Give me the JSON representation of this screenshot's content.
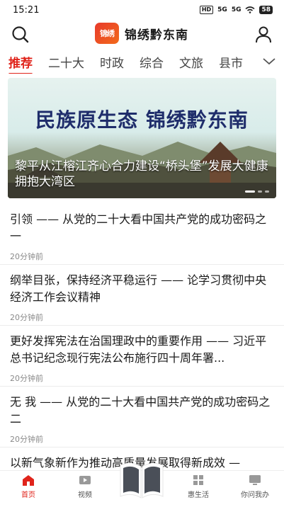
{
  "status_bar": {
    "time": "15:21",
    "network_hd": "HD",
    "signal_1": "5G",
    "signal_2": "5G",
    "battery": "58"
  },
  "header": {
    "logo_mark": "锦绣",
    "app_name": "锦绣黔东南",
    "search_icon": "search-icon",
    "user_icon": "user-icon"
  },
  "tabs": [
    {
      "label": "推荐",
      "active": true
    },
    {
      "label": "二十大",
      "active": false
    },
    {
      "label": "时政",
      "active": false
    },
    {
      "label": "综合",
      "active": false
    },
    {
      "label": "文旅",
      "active": false
    },
    {
      "label": "县市",
      "active": false
    }
  ],
  "banner": {
    "slogan": "民族原生态  锦绣黔东南",
    "caption": "黎平从江榕江齐心合力建设“桥头堡”发展大健康拥抱大湾区"
  },
  "news": [
    {
      "title": "引领 —— 从党的二十大看中国共产党的成功密码之一",
      "time": "20分钟前"
    },
    {
      "title": "纲举目张，保持经济平稳运行 —— 论学习贯彻中央经济工作会议精神",
      "time": "20分钟前"
    },
    {
      "title": "更好发挥宪法在治国理政中的重要作用 —— 习近平总书记纪念现行宪法公布施行四十周年署...",
      "time": "20分钟前"
    },
    {
      "title": "无 我 —— 从党的二十大看中国共产党的成功密码之二",
      "time": "20分钟前"
    },
    {
      "title": "以新气象新作为推动高质量发展取得新成效 —",
      "time": ""
    }
  ],
  "bottom_nav": [
    {
      "label": "首页",
      "icon": "home-icon",
      "active": true
    },
    {
      "label": "视频",
      "icon": "video-icon",
      "active": false
    },
    {
      "label": "",
      "icon": "book-icon",
      "active": false
    },
    {
      "label": "惠生活",
      "icon": "grid-icon",
      "active": false
    },
    {
      "label": "你问我办",
      "icon": "monitor-icon",
      "active": false
    }
  ],
  "colors": {
    "accent": "#e0241b",
    "slogan": "#1f2d6b"
  }
}
